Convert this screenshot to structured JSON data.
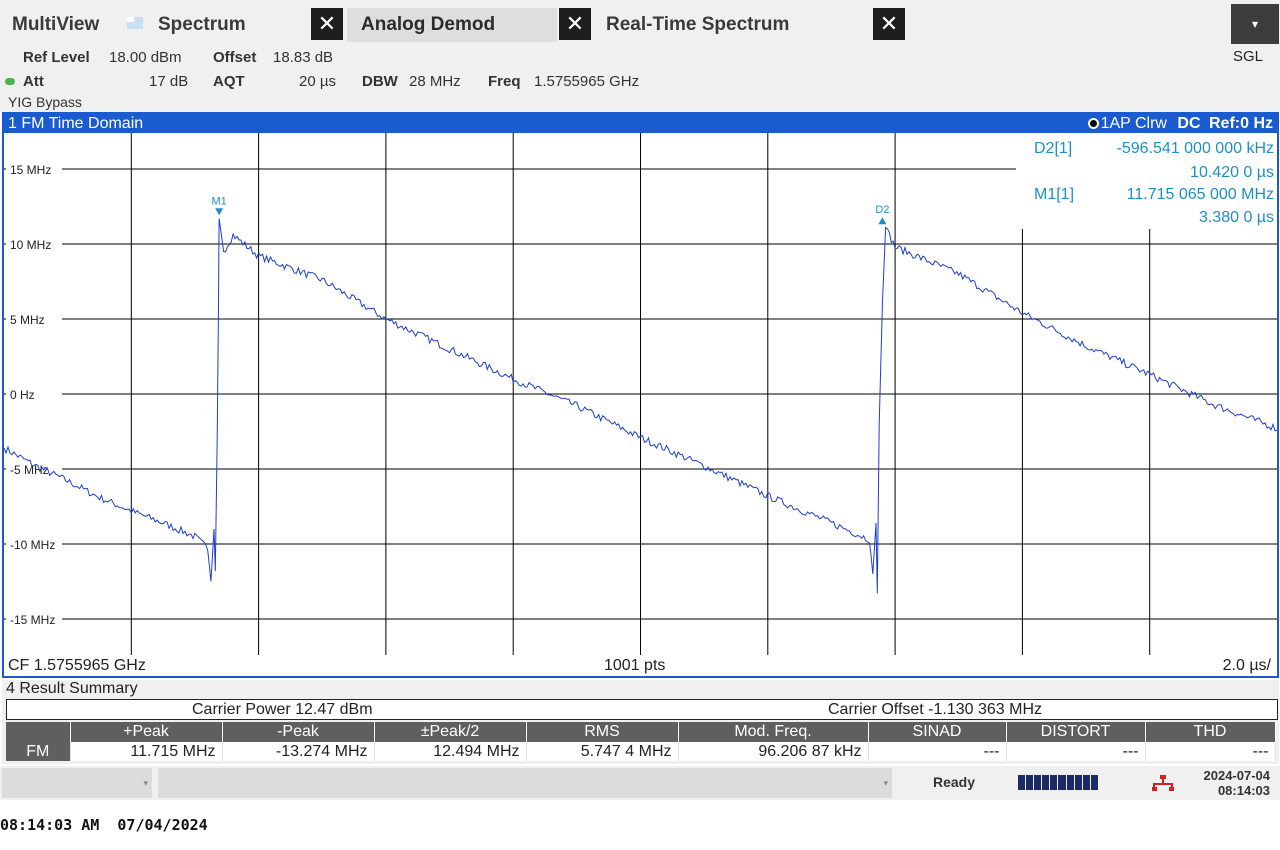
{
  "tabs": [
    {
      "label": "MultiView",
      "icon": "multiview-icon"
    },
    {
      "label": "Spectrum",
      "close": "✕"
    },
    {
      "label": "Analog Demod",
      "close": "✕",
      "active": true
    },
    {
      "label": "Real-Time Spectrum",
      "close": "✕"
    }
  ],
  "menu_button": "▾",
  "sgl": "SGL",
  "settings": {
    "ref_level_label": "Ref Level",
    "ref_level_value": "18.00 dBm",
    "offset_label": "Offset",
    "offset_value": "18.83 dB",
    "att_label": "Att",
    "att_value": "17 dB",
    "aqt_label": "AQT",
    "aqt_value": "20 µs",
    "dbw_label": "DBW",
    "dbw_value": "28 MHz",
    "freq_label": "Freq",
    "freq_value": "1.5755965 GHz",
    "yig": "YIG Bypass"
  },
  "diagram": {
    "title": "1 FM Time Domain",
    "trace_info": "1AP Clrw",
    "coupling": "DC",
    "ref": "Ref:0 Hz",
    "footer_cf": "CF 1.5755965 GHz",
    "footer_pts": "1001 pts",
    "footer_span": "2.0 µs/",
    "markers": {
      "d2_label": "D2[1]",
      "d2_value": "-596.541 000 000 kHz",
      "d2_time": "10.420 0 µs",
      "m1_label": "M1[1]",
      "m1_value": "11.715 065 000 MHz",
      "m1_time": "3.380 0 µs"
    }
  },
  "chart_data": {
    "type": "line",
    "title": "1 FM Time Domain",
    "xlabel": "",
    "ylabel": "",
    "x_unit": "µs",
    "xlim": [
      0,
      20
    ],
    "ylim": [
      -17.4,
      17.4
    ],
    "y_ticks": [
      15,
      10,
      5,
      0,
      -5,
      -10,
      -15
    ],
    "y_tick_labels": [
      "15 MHz",
      "10 MHz",
      "5 MHz",
      "0 Hz",
      "-5 MHz",
      "-10 MHz",
      "-15 MHz"
    ],
    "grid": true,
    "trace_color": "#1e3fd0",
    "series": [
      {
        "points": [
          [
            0,
            -3.6
          ],
          [
            0.5,
            -4.8
          ],
          [
            1.0,
            -5.8
          ],
          [
            1.5,
            -6.9
          ],
          [
            2.0,
            -7.8
          ],
          [
            2.5,
            -8.6
          ],
          [
            3.0,
            -9.5
          ],
          [
            3.2,
            -10.3
          ],
          [
            3.25,
            -12.5
          ],
          [
            3.3,
            -9.0
          ],
          [
            3.32,
            -11.8
          ],
          [
            3.35,
            -3.0
          ],
          [
            3.37,
            6.0
          ],
          [
            3.38,
            11.7
          ],
          [
            3.45,
            9.5
          ],
          [
            3.6,
            10.6
          ],
          [
            4.0,
            9.2
          ],
          [
            5.0,
            7.6
          ],
          [
            6.0,
            5.0
          ],
          [
            7.0,
            3.0
          ],
          [
            8.0,
            1.0
          ],
          [
            9.0,
            -0.8
          ],
          [
            10.0,
            -2.9
          ],
          [
            11.0,
            -4.8
          ],
          [
            12.0,
            -6.8
          ],
          [
            13.0,
            -8.6
          ],
          [
            13.6,
            -9.7
          ],
          [
            13.65,
            -12.0
          ],
          [
            13.7,
            -8.6
          ],
          [
            13.72,
            -13.3
          ],
          [
            13.75,
            -2.0
          ],
          [
            13.8,
            6.0
          ],
          [
            13.83,
            9.0
          ],
          [
            13.85,
            11.1
          ],
          [
            14.0,
            9.8
          ],
          [
            15.0,
            8.0
          ],
          [
            16.0,
            5.4
          ],
          [
            17.0,
            3.2
          ],
          [
            18.0,
            1.3
          ],
          [
            19.0,
            -0.7
          ],
          [
            20.0,
            -2.3
          ]
        ]
      }
    ],
    "markers": [
      {
        "name": "M1",
        "x": 3.38,
        "y": 11.715
      },
      {
        "name": "D2",
        "x": 13.8,
        "y": 11.118
      }
    ]
  },
  "result_summary": {
    "title": "4 Result Summary",
    "carrier_power": "Carrier Power  12.47 dBm",
    "carrier_offset": "Carrier Offset  -1.130 363 MHz",
    "columns": [
      "+Peak",
      "-Peak",
      "±Peak/2",
      "RMS",
      "Mod. Freq.",
      "SINAD",
      "DISTORT",
      "THD"
    ],
    "row_label": "FM",
    "row_values": [
      "11.715 MHz",
      "-13.274 MHz",
      "12.494 MHz",
      "5.747 4 MHz",
      "96.206 87 kHz",
      "---",
      "---",
      "---"
    ]
  },
  "status": {
    "ready": "Ready",
    "date": "2024-07-04",
    "time": "08:14:03",
    "dropdown_arrow": "▾"
  },
  "os_clock": "08:14:03 AM  07/04/2024"
}
